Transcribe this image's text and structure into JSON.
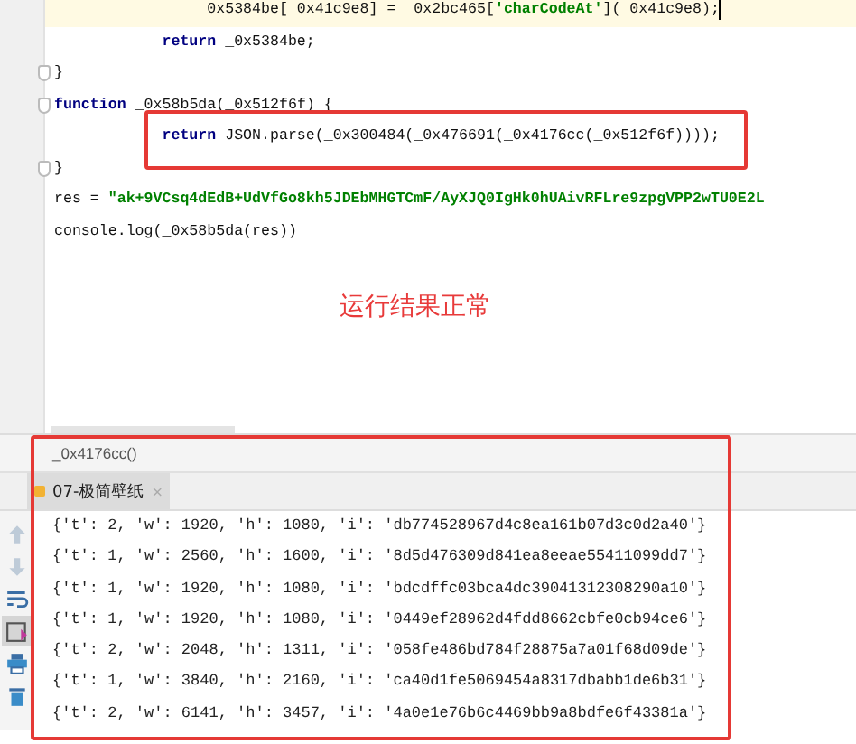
{
  "editor": {
    "lines": [
      {
        "current": true,
        "fold": false,
        "boxed": false,
        "tokens": [
          {
            "kind": "plain",
            "text": "                _0x5384be[_0x41c9e8] = _0x2bc465["
          },
          {
            "kind": "str",
            "text": "'charCodeAt'"
          },
          {
            "kind": "plain",
            "text": "](_0x41c9e8);"
          }
        ]
      },
      {
        "current": false,
        "fold": false,
        "boxed": false,
        "tokens": [
          {
            "kind": "kw",
            "text": "            return"
          },
          {
            "kind": "plain",
            "text": " _0x5384be;"
          }
        ]
      },
      {
        "current": false,
        "fold": true,
        "boxed": false,
        "tokens": [
          {
            "kind": "plain",
            "text": "}"
          }
        ]
      },
      {
        "current": false,
        "fold": true,
        "boxed": false,
        "tokens": [
          {
            "kind": "kw",
            "text": "function"
          },
          {
            "kind": "plain",
            "text": " _0x58b5da(_0x512f6f) {"
          }
        ]
      },
      {
        "current": false,
        "fold": false,
        "boxed": true,
        "tokens": [
          {
            "kind": "kw",
            "text": "            return"
          },
          {
            "kind": "plain",
            "text": " JSON.parse(_0x300484(_0x476691(_0x4176cc(_0x512f6f))));"
          }
        ]
      },
      {
        "current": false,
        "fold": true,
        "boxed": false,
        "tokens": [
          {
            "kind": "plain",
            "text": "}"
          }
        ]
      },
      {
        "current": false,
        "fold": false,
        "boxed": false,
        "tokens": [
          {
            "kind": "plain",
            "text": "res = "
          },
          {
            "kind": "str",
            "text": "\"ak+9VCsq4dEdB+UdVfGo8kh5JDEbMHGTCmF/AyXJQ0IgHk0hUAivRFLre9zpgVPP2wTU0E2L"
          }
        ]
      },
      {
        "current": false,
        "fold": false,
        "boxed": false,
        "tokens": [
          {
            "kind": "plain",
            "text": "console.log(_0x58b5da(res))"
          }
        ]
      }
    ]
  },
  "annotation": "运行结果正常",
  "breadcrumb": "_0x4176cc()",
  "run_panel": {
    "boxed": true,
    "tabs": [
      {
        "label": "07-极简壁纸",
        "close": "×",
        "selected": true
      }
    ],
    "tools": [
      {
        "kind": "up",
        "disabled": true,
        "selected": false
      },
      {
        "kind": "down",
        "disabled": true,
        "selected": false
      },
      {
        "kind": "wrap",
        "disabled": false,
        "selected": false
      },
      {
        "kind": "scroll",
        "disabled": false,
        "selected": true
      },
      {
        "kind": "print",
        "disabled": false,
        "selected": false
      },
      {
        "kind": "trash",
        "disabled": false,
        "selected": false
      }
    ],
    "output": [
      "{'t': 2, 'w': 1920, 'h': 1080, 'i': 'db774528967d4c8ea161b07d3c0d2a40'}",
      "{'t': 1, 'w': 2560, 'h': 1600, 'i': '8d5d476309d841ea8eeae55411099dd7'}",
      "{'t': 1, 'w': 1920, 'h': 1080, 'i': 'bdcdffc03bca4dc39041312308290a10'}",
      "{'t': 1, 'w': 1920, 'h': 1080, 'i': '0449ef28962d4fdd8662cbfe0cb94ce6'}",
      "{'t': 2, 'w': 2048, 'h': 1311, 'i': '058fe486bd784f28875a7a01f68d09de'}",
      "{'t': 1, 'w': 3840, 'h': 2160, 'i': 'ca40d1fe5069454a8317dbabb1de6b31'}",
      "{'t': 2, 'w': 6141, 'h': 3457, 'i': '4a0e1e76b6c4469bb9a8bdfe6f43381a'}"
    ]
  }
}
